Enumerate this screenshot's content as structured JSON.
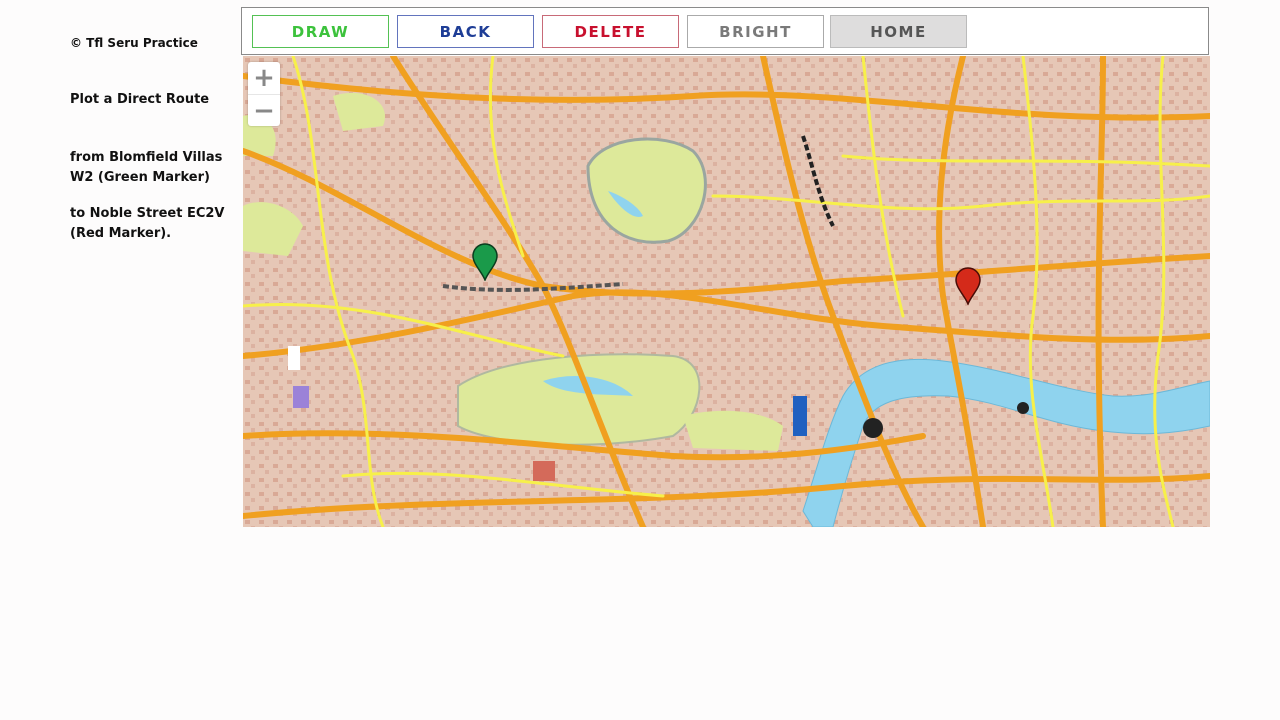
{
  "sidebar": {
    "copyright": "© Tfl Seru Practice",
    "instruction_title": "Plot a Direct Route",
    "from": "from Blomfield Villas W2 (Green Marker)",
    "to": "to Noble Street EC2V (Red Marker)."
  },
  "toolbar": {
    "draw": "DRAW",
    "back": "BACK",
    "delete": "DELETE",
    "bright": "BRIGHT",
    "home": "HOME"
  },
  "map": {
    "zoom_in": "+",
    "zoom_out": "−",
    "markers": [
      {
        "name": "start",
        "color": "#1a9a4a"
      },
      {
        "name": "destination",
        "color": "#d42a1a"
      }
    ],
    "colors": {
      "park": "#dde99a",
      "water": "#8fd3ee",
      "major_road": "#f0a020",
      "minor_road": "#f7f04a",
      "urban": "#e7c9b9"
    }
  }
}
